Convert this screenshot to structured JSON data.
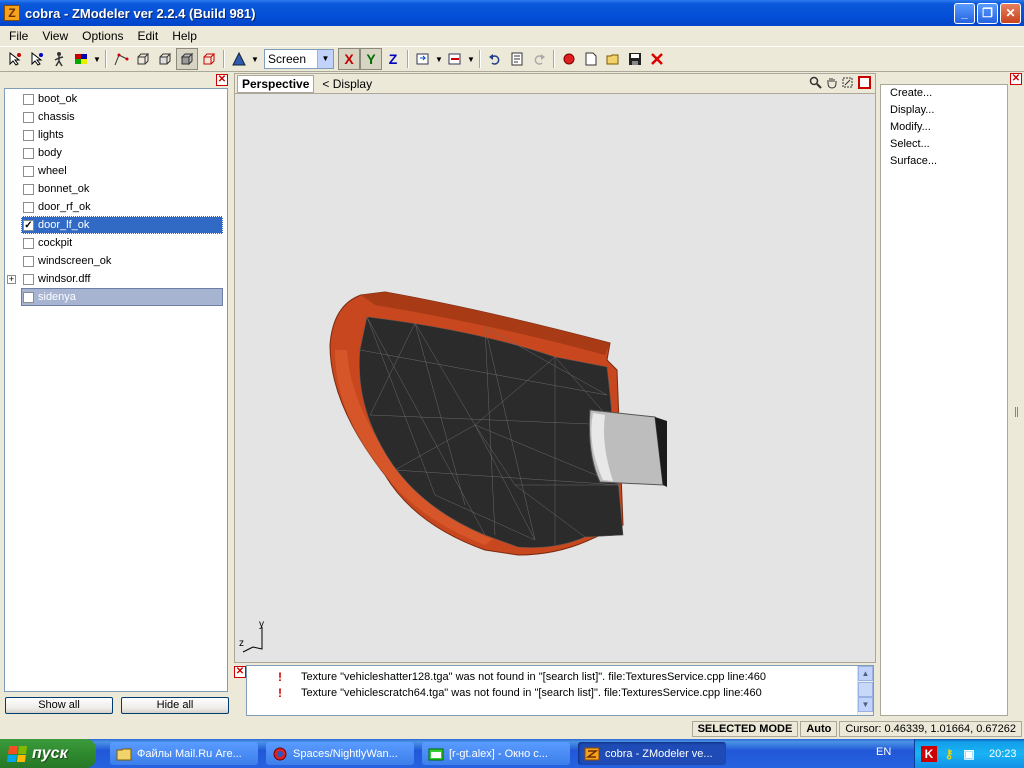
{
  "window": {
    "title": "cobra - ZModeler ver 2.2.4 (Build 981)",
    "icon_letter": "Z",
    "minimize": "_",
    "maximize": "❐",
    "close": "✕"
  },
  "menu": [
    {
      "label": "File"
    },
    {
      "label": "View"
    },
    {
      "label": "Options"
    },
    {
      "label": "Edit"
    },
    {
      "label": "Help"
    }
  ],
  "toolbar": {
    "coord_select": "Screen",
    "axis_x": "X",
    "axis_y": "Y",
    "axis_z": "Z"
  },
  "tree": {
    "items": [
      {
        "label": "boot_ok",
        "checked": false
      },
      {
        "label": "chassis",
        "checked": false
      },
      {
        "label": "lights",
        "checked": false
      },
      {
        "label": "body",
        "checked": false
      },
      {
        "label": "wheel",
        "checked": false
      },
      {
        "label": "bonnet_ok",
        "checked": false
      },
      {
        "label": "door_rf_ok",
        "checked": false
      },
      {
        "label": "door_lf_ok",
        "checked": true
      },
      {
        "label": "cockpit",
        "checked": false
      },
      {
        "label": "windscreen_ok",
        "checked": false
      },
      {
        "label": "windsor.dff",
        "checked": false
      },
      {
        "label": "sidenya",
        "checked": false
      }
    ],
    "check_mark": "✓",
    "expand_mark": "+"
  },
  "left_buttons": {
    "show_all": "Show all",
    "hide_all": "Hide all"
  },
  "viewport": {
    "tab": "Perspective",
    "display": "<  Display",
    "axis_y": "y",
    "axis_z": "z",
    "colors": {
      "background": "#E4E4E4",
      "door_orange": "#C8471E",
      "door_dark": "#2B2B2B",
      "handle": "#BDBDBD"
    }
  },
  "right_panel": {
    "items": [
      "Create...",
      "Display...",
      "Modify...",
      "Select...",
      "Surface..."
    ]
  },
  "log": {
    "lines": [
      "Texture \"vehicleshatter128.tga\" was not found in \"[search list]\". file:TexturesService.cpp line:460",
      "Texture \"vehiclescratch64.tga\" was not found in \"[search list]\". file:TexturesService.cpp line:460"
    ],
    "warn_mark": "!"
  },
  "status": {
    "mode": "SELECTED MODE",
    "auto": "Auto",
    "cursor": "Cursor: 0.46339, 1.01664, 0.67262"
  },
  "taskbar": {
    "start": "пуск",
    "items": [
      {
        "label": "Файлы Mail.Ru Аге..."
      },
      {
        "label": "Spaces/NightlyWan..."
      },
      {
        "label": "[r-gt.alex] - Окно с..."
      },
      {
        "label": "cobra - ZModeler ve..."
      }
    ],
    "lang": "EN",
    "clock": "20:23"
  }
}
